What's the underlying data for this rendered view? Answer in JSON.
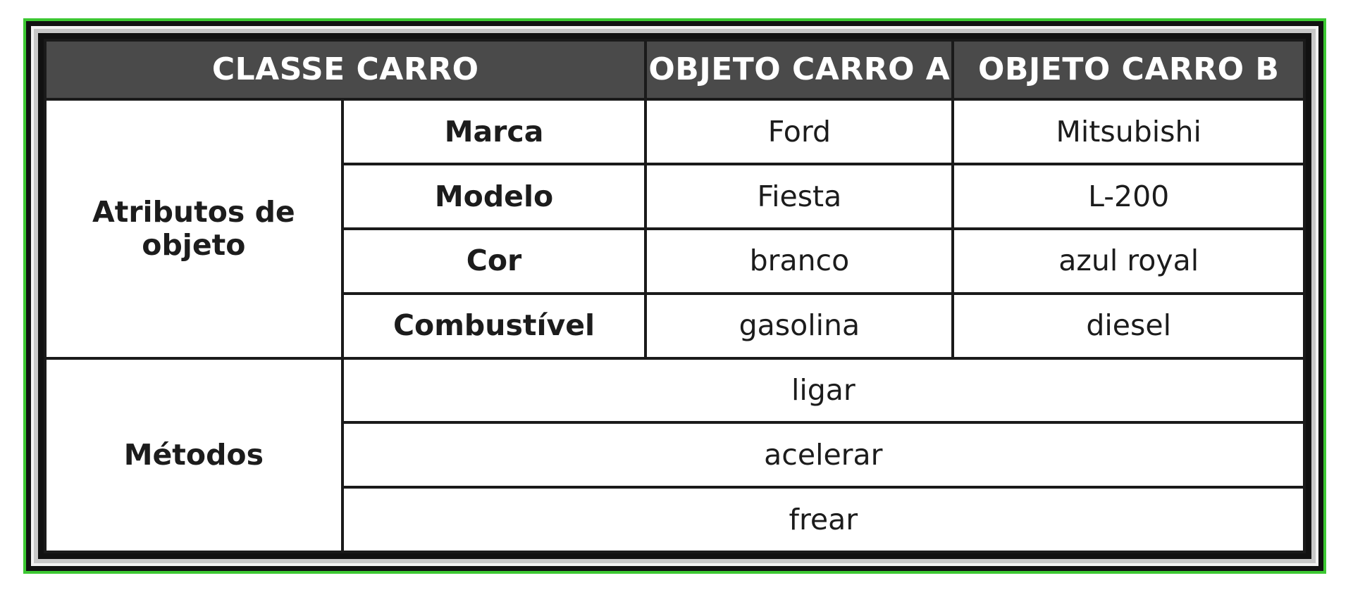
{
  "header": {
    "class_label": "CLASSE CARRO",
    "object_a_label": "OBJETO CARRO A",
    "object_b_label": "OBJETO CARRO B"
  },
  "attributes": {
    "group_label": "Atributos de objeto",
    "rows": [
      {
        "name": "Marca",
        "a": "Ford",
        "b": "Mitsubishi"
      },
      {
        "name": "Modelo",
        "a": "Fiesta",
        "b": "L-200"
      },
      {
        "name": "Cor",
        "a": "branco",
        "b": "azul royal"
      },
      {
        "name": "Combustível",
        "a": "gasolina",
        "b": "diesel"
      }
    ]
  },
  "methods": {
    "group_label": "Métodos",
    "items": [
      "ligar",
      "acelerar",
      "frear"
    ]
  },
  "colors": {
    "frame_accent": "#3cc832",
    "header_background": "#4a4a4a",
    "header_text": "#ffffff"
  }
}
